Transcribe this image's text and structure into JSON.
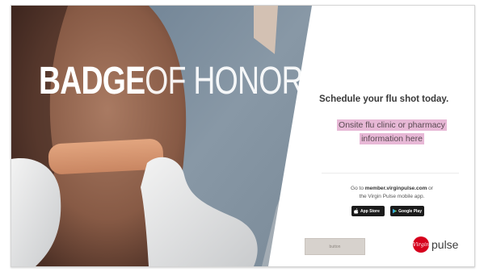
{
  "headline": {
    "bold": "BADGE",
    "light": "OF HONOR"
  },
  "schedule_text": "Schedule your flu shot today.",
  "placeholder": {
    "line1": "Onsite flu clinic or pharmacy",
    "line2": "information here"
  },
  "goto": {
    "prefix": "Go to ",
    "site": "member.virginpulse.com",
    "suffix": " or",
    "line2": "the Virgin Pulse mobile app."
  },
  "stores": {
    "apple": "App Store",
    "google": "Google Play"
  },
  "button_label": "button",
  "logo": {
    "mark": "Virgin",
    "word": "pulse"
  },
  "colors": {
    "placeholder_highlight": "#e7b8d6",
    "logo_red": "#d6001c",
    "button_bg": "#d7d2cd"
  }
}
